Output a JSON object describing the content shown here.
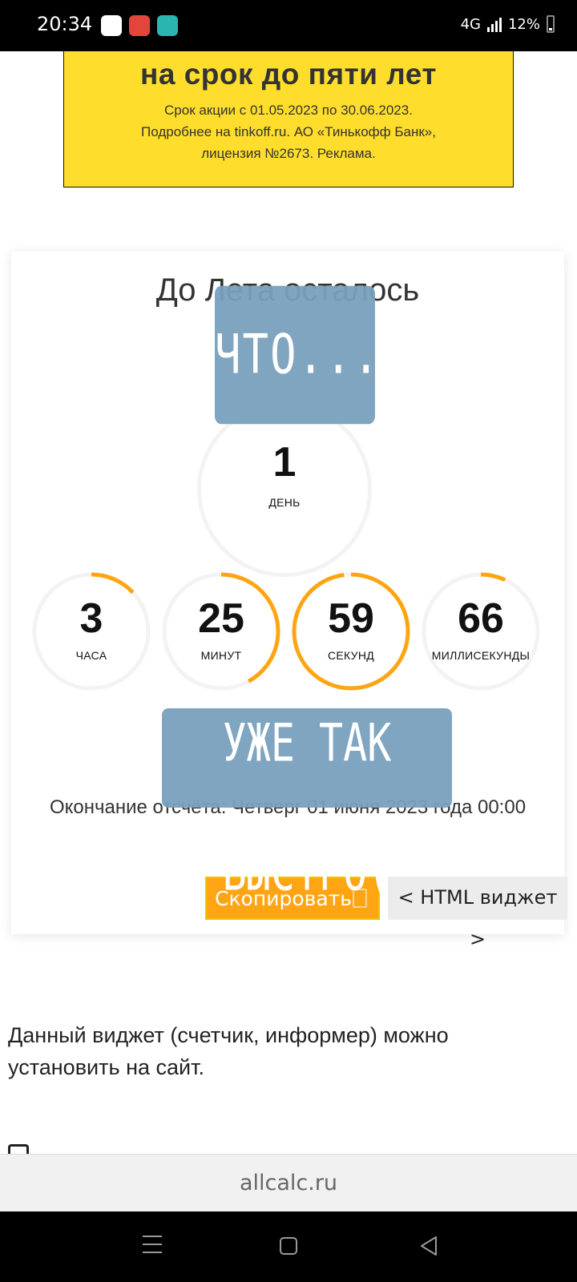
{
  "status_bar": {
    "time": "20:34",
    "network": "4G",
    "battery": "12%"
  },
  "ad": {
    "headline": "на срок до пяти лет",
    "lines": [
      "Срок акции с 01.05.2023 по 30.06.2023.",
      "Подробнее на tinkoff.ru. АО «Тинькофф Банк»,",
      "лицензия №2673. Реклама."
    ]
  },
  "countdown": {
    "title": "До Лета осталось",
    "days": {
      "value": "1",
      "label": "ДЕНЬ"
    },
    "hours": {
      "value": "3",
      "label": "ЧАСА",
      "progress": 0.13
    },
    "minutes": {
      "value": "25",
      "label": "МИНУТ",
      "progress": 0.42
    },
    "seconds": {
      "value": "59",
      "label": "СЕКУНД",
      "progress": 0.98
    },
    "milliseconds": {
      "value": "66",
      "label": "МИЛЛИСЕКУНДЫ",
      "progress": 0.07
    },
    "end_time": "Окончание отсчёта: Четверг 01 июня 2023 года 00:00",
    "accent_color": "#ffa514"
  },
  "buttons": {
    "copy": "Скопировать",
    "html_widget": "< HTML виджет >"
  },
  "stickers": {
    "top": "ЧТО...",
    "bottom": "УЖЕ ТАК БЫСТРО("
  },
  "description": "Данный виджет (счетчик, информер) можно установить на сайт.",
  "browser": {
    "url": "allcalc.ru"
  }
}
